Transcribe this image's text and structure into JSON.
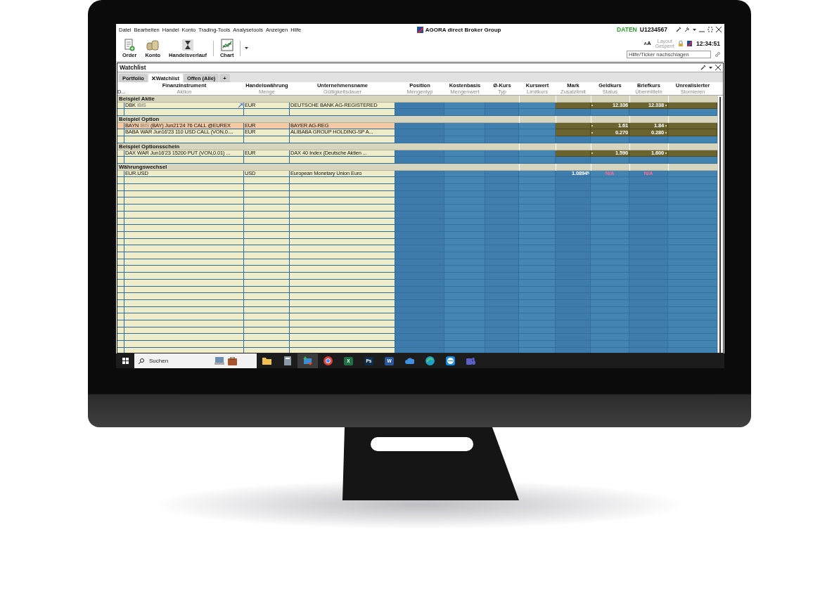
{
  "title_bar": {
    "menu": [
      "Datei",
      "Bearbeiten",
      "Handel",
      "Konto",
      "Trading-Tools",
      "Analysetools",
      "Anzeigen",
      "Hilfe"
    ],
    "app_title": "AGORA direct Broker Group",
    "data_label": "DATEN",
    "account": "U1234567"
  },
  "toolbar": {
    "buttons": [
      {
        "label": "Order",
        "kind": "order"
      },
      {
        "label": "Konto",
        "kind": "coins"
      },
      {
        "label": "Handelsverlauf",
        "kind": "hourglass"
      },
      {
        "label": "Chart",
        "kind": "chart"
      }
    ],
    "font_size_toggle": "AA",
    "layout_status": [
      "Layout",
      "Gesperrt"
    ],
    "time": "12:34:51",
    "search": {
      "placeholder": "Hilfe/Ticker nachschlagen"
    }
  },
  "watchlist": {
    "title": "Watchlist",
    "tabs": [
      {
        "label": "Portfolio",
        "selected": false,
        "closable": false
      },
      {
        "label": "Watchlist",
        "selected": true,
        "closable": true
      },
      {
        "label": "Offen (Alle)",
        "selected": false,
        "closable": false
      }
    ],
    "add_tab": "+",
    "columns": [
      {
        "sublabel": "D..."
      },
      {
        "label": "Finanzinstrument",
        "sublabel": "Aktion"
      },
      {
        "label": "Handelswährung",
        "sublabel": "Menge"
      },
      {
        "label": "Unternehmensname",
        "sublabel": "Gültigkeitsdauer"
      },
      {
        "label": "Position",
        "sublabel": "Mengentyp"
      },
      {
        "label": "Kostenbasis",
        "sublabel": "Mengenwert"
      },
      {
        "label": "Ø-Kurs",
        "sublabel": "Typ"
      },
      {
        "label": "Kurswert",
        "sublabel": "Limitkurs"
      },
      {
        "label": "Mark",
        "sublabel": "Zusatzlimit"
      },
      {
        "label": "Geldkurs",
        "sublabel": "Status"
      },
      {
        "label": "Briefkurs",
        "sublabel": "Übermitteln"
      },
      {
        "label": "Unrealisierter",
        "sublabel": "Stornieren"
      }
    ],
    "groups": [
      {
        "title": "Beispiel Aktie",
        "rows": [
          {
            "symbol": "DBK",
            "tag": "IBIS",
            "linked": true,
            "currency": "EUR",
            "company": "DEUTSCHE BANK AG-REGISTERED",
            "quote": true,
            "bid": "12.336",
            "ask": "12.338",
            "selected": false
          }
        ]
      },
      {
        "title": "Beispiel Option",
        "rows": [
          {
            "symbol": "BAYN",
            "tag": "IBIS",
            "detail": "(BAY) Jun21'24 76 CALL @EUREX",
            "linked": false,
            "currency": "EUR",
            "company": "BAYER AG-REG",
            "quote": true,
            "bid": "1.61",
            "ask": "1.84",
            "selected": true
          },
          {
            "symbol": "BABA",
            "detail": "WAR Jun16'23 110 USD CALL (VON,0....",
            "linked": false,
            "currency": "EUR",
            "company": "ALIBABA GROUP HOLDING-SP A...",
            "quote": true,
            "bid": "0.270",
            "ask": "0.280",
            "selected": false
          }
        ]
      },
      {
        "title": "Beispiel Optionsschein",
        "rows": [
          {
            "symbol": "DAX",
            "detail": "WAR Jun16'23 15200 PUT (VON,0.01) ...",
            "linked": false,
            "currency": "EUR",
            "company": "DAX 40 Index (Deutsche Aktien ...",
            "quote": true,
            "bid": "1.590",
            "ask": "1.600",
            "selected": false
          }
        ]
      },
      {
        "title": "Währungswechsel",
        "rows": [
          {
            "symbol": "EUR.USD",
            "linked": false,
            "currency": "USD",
            "company": "European Monetary Union Euro",
            "quote": false,
            "mark": "1.0894$^{5}$",
            "bid": "N/A",
            "ask": "N/A",
            "selected": false
          }
        ]
      }
    ]
  },
  "taskbar": {
    "search": {
      "placeholder": "Suchen"
    },
    "apps": [
      {
        "kind": "folder",
        "color": "#f2c14e",
        "selected": false
      },
      {
        "kind": "calculator",
        "color": "#8a9aa8",
        "selected": false
      },
      {
        "kind": "trader",
        "color": "#3a8fd8",
        "selected": true
      },
      {
        "kind": "browser",
        "color": "#db4437",
        "selected": false
      },
      {
        "kind": "sheet",
        "color": "#1e7145",
        "glyph": "X",
        "selected": false
      },
      {
        "kind": "sheet",
        "color": "#0d2b4a",
        "glyph": "Ps",
        "selected": false
      },
      {
        "kind": "sheet",
        "color": "#2b579a",
        "glyph": "W",
        "selected": false
      },
      {
        "kind": "cloud",
        "color": "#3d8fe0",
        "selected": false
      },
      {
        "kind": "globe",
        "color": "#1fa0c8",
        "selected": false
      },
      {
        "kind": "remote",
        "color": "#0e8ee9",
        "selected": false
      },
      {
        "kind": "chat",
        "color": "#5b5fc7",
        "selected": false
      }
    ]
  }
}
